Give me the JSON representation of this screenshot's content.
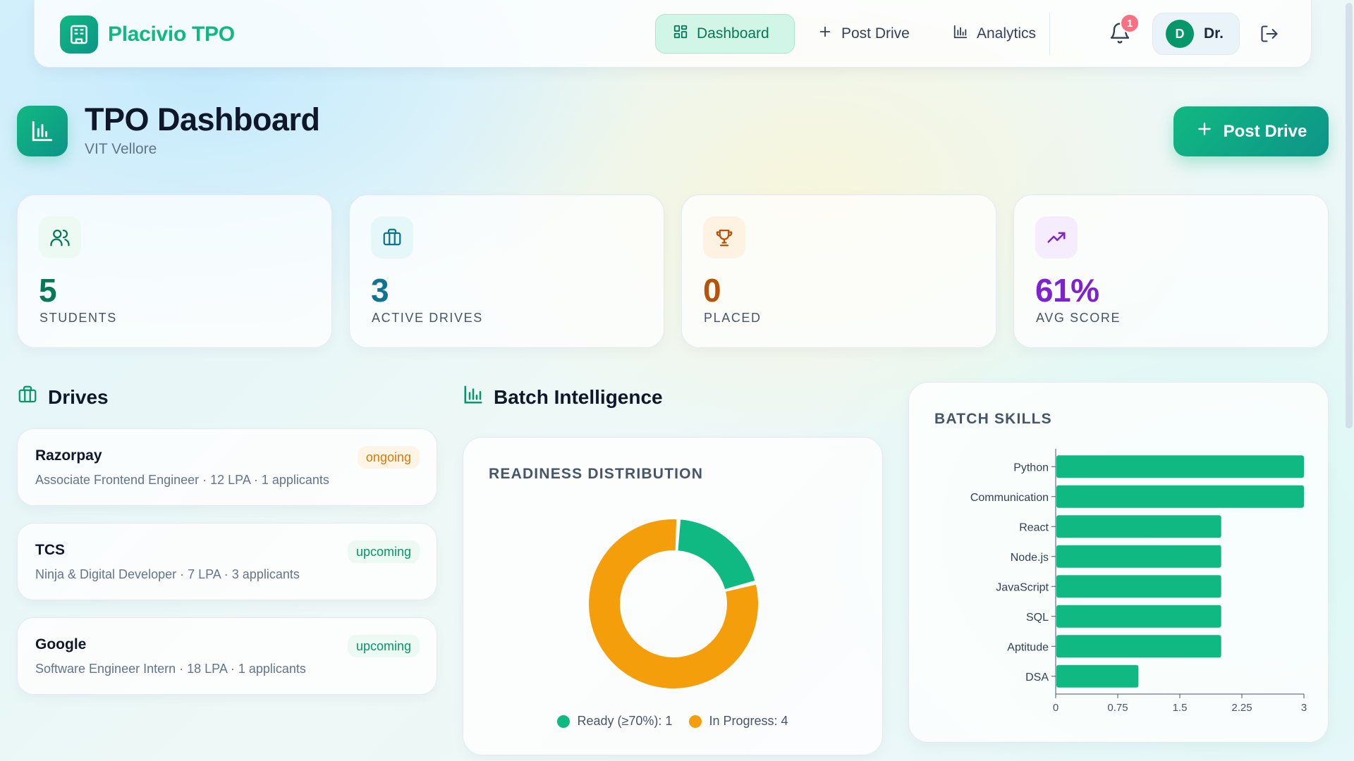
{
  "nav": {
    "brand": "Placivio TPO",
    "links": [
      {
        "label": "Dashboard",
        "icon": "grid-icon",
        "active": true
      },
      {
        "label": "Post Drive",
        "icon": "plus-icon",
        "active": false
      },
      {
        "label": "Analytics",
        "icon": "bar-chart-icon",
        "active": false
      }
    ],
    "notification_count": "1",
    "user_initial": "D",
    "user_name": "Dr."
  },
  "header": {
    "title": "TPO Dashboard",
    "subtitle": "VIT Vellore",
    "post_drive_label": "Post Drive"
  },
  "stats": [
    {
      "value": "5",
      "label": "STUDENTS",
      "icon": "users-icon",
      "color": "#047857",
      "bg": "#ecfaf3"
    },
    {
      "value": "3",
      "label": "ACTIVE DRIVES",
      "icon": "briefcase-icon",
      "color": "#0e7490",
      "bg": "#e6f7fa"
    },
    {
      "value": "0",
      "label": "PLACED",
      "icon": "trophy-icon",
      "color": "#b45309",
      "bg": "#fef3e2"
    },
    {
      "value": "61%",
      "label": "AVG SCORE",
      "icon": "trending-up-icon",
      "color": "#7e22ce",
      "bg": "#f5ecfd"
    }
  ],
  "drives_section": {
    "title": "Drives",
    "items": [
      {
        "company": "Razorpay",
        "meta": "Associate Frontend Engineer · 12 LPA · 1 applicants",
        "status": "ongoing"
      },
      {
        "company": "TCS",
        "meta": "Ninja & Digital Developer · 7 LPA · 3 applicants",
        "status": "upcoming"
      },
      {
        "company": "Google",
        "meta": "Software Engineer Intern · 18 LPA · 1 applicants",
        "status": "upcoming"
      }
    ]
  },
  "batch_section": {
    "title": "Batch Intelligence"
  },
  "colors": {
    "ready": "#10b981",
    "in_progress": "#f59e0b",
    "bar": "#10b981"
  },
  "chart_data": [
    {
      "type": "pie",
      "title": "READINESS DISTRIBUTION",
      "slices": [
        {
          "label": "Ready (≥70%)",
          "value": 1,
          "legend": "Ready (≥70%): 1"
        },
        {
          "label": "In Progress",
          "value": 4,
          "legend": "In Progress: 4"
        }
      ]
    },
    {
      "type": "bar",
      "orientation": "horizontal",
      "title": "BATCH SKILLS",
      "categories": [
        "Python",
        "Communication",
        "React",
        "Node.js",
        "JavaScript",
        "SQL",
        "Aptitude",
        "DSA"
      ],
      "values": [
        3,
        3,
        2,
        2,
        2,
        2,
        2,
        1
      ],
      "xlim": [
        0,
        3
      ],
      "xticks": [
        "0",
        "0.75",
        "1.5",
        "2.25",
        "3"
      ]
    }
  ]
}
